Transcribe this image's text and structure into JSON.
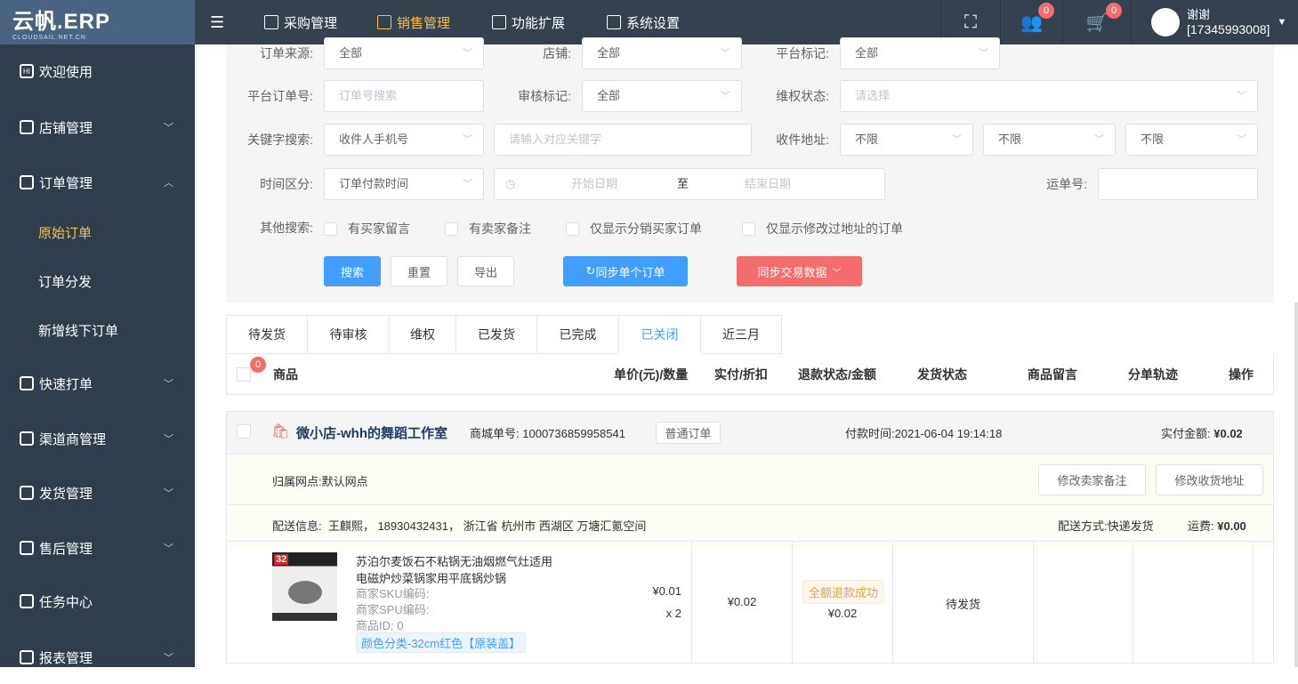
{
  "logo": {
    "text": "云帆.ERP",
    "sub": "CLOUDSAIL.NET.CN"
  },
  "sidebar": {
    "items": [
      {
        "label": "欢迎使用",
        "icon": "hi"
      },
      {
        "label": "店铺管理"
      },
      {
        "label": "订单管理"
      },
      {
        "label": "快速打单"
      },
      {
        "label": "渠道商管理"
      },
      {
        "label": "发货管理"
      },
      {
        "label": "售后管理"
      },
      {
        "label": "任务中心"
      },
      {
        "label": "报表管理"
      }
    ],
    "subitems": [
      {
        "label": "原始订单"
      },
      {
        "label": "订单分发"
      },
      {
        "label": "新增线下订单"
      }
    ]
  },
  "topnav": [
    {
      "label": "采购管理"
    },
    {
      "label": "销售管理"
    },
    {
      "label": "功能扩展"
    },
    {
      "label": "系统设置"
    }
  ],
  "header": {
    "team_badge": "0",
    "cart_badge": "0",
    "user_name": "谢谢",
    "user_phone": "[17345993008]"
  },
  "filter": {
    "order_source_label": "订单来源:",
    "order_source": "全部",
    "shop_label": "店铺:",
    "shop": "全部",
    "platform_mark_label": "平台标记:",
    "platform_mark": "全部",
    "platform_order_label": "平台订单号:",
    "platform_order_placeholder": "订单号搜索",
    "audit_mark_label": "审核标记:",
    "audit_mark": "全部",
    "rights_label": "维权状态:",
    "rights_placeholder": "请选择",
    "keyword_label": "关键字搜索:",
    "keyword_type": "收件人手机号",
    "keyword_placeholder": "请输入对应关键字",
    "address_label": "收件地址:",
    "addr1": "不限",
    "addr2": "不限",
    "addr3": "不限",
    "time_label": "时间区分:",
    "time_type": "订单付款时间",
    "start_placeholder": "开始日期",
    "to": "至",
    "end_placeholder": "结束日期",
    "waybill_label": "运单号:",
    "other_label": "其他搜索:",
    "checks": [
      "有买家留言",
      "有卖家备注",
      "仅显示分销买家订单",
      "仅显示修改过地址的订单"
    ],
    "search": "搜索",
    "reset": "重置",
    "export": "导出",
    "sync_one": "同步单个订单",
    "sync_trade": "同步交易数据"
  },
  "tabs": [
    "待发货",
    "待审核",
    "维权",
    "已发货",
    "已完成",
    "已关闭",
    "近三月"
  ],
  "table_headers": {
    "badge": "0",
    "product": "商品",
    "price_qty": "单价(元)/数量",
    "paid": "实付/折扣",
    "refund": "退款状态/金额",
    "ship": "发货状态",
    "msg": "商品留言",
    "track": "分单轨迹",
    "op": "操作"
  },
  "order": {
    "shop": "微小店-whh的舞蹈工作室",
    "mall_no_label": "商城单号:",
    "mall_no": "100073685995854​1",
    "type": "普通订单",
    "pay_time_label": "付款时间:",
    "pay_time": "2021-06-04 19:14:18",
    "paid_label": "实付金额:",
    "paid": "¥0.02",
    "outlet": "归属网点:默认网点",
    "edit_note": "修改卖家备注",
    "edit_addr": "修改收货地址",
    "delivery": "配送信息:  王麒熙， 18930432431， 浙江省 杭州市 西湖区 万塘汇氪空间",
    "ship_method_label": "配送方式:",
    "ship_method": "快递发货",
    "freight_label": "运费:",
    "freight": "¥0.00",
    "item": {
      "title1": "苏泊尔麦饭石不粘锅无油烟燃气灶适用",
      "title2": "电磁炉炒菜锅家用平底锅炒锅",
      "sku": "商家SKU编码:",
      "spu": "商家SPU编码:",
      "pid": "商品ID:  0",
      "spec": "颜色分类-32cm红色【原装盖】",
      "price": "¥0.01",
      "qty": "x 2",
      "paid": "¥0.02",
      "refund_status": "全额退款成功",
      "refund_amt": "¥0.02",
      "ship": "待发货"
    }
  }
}
